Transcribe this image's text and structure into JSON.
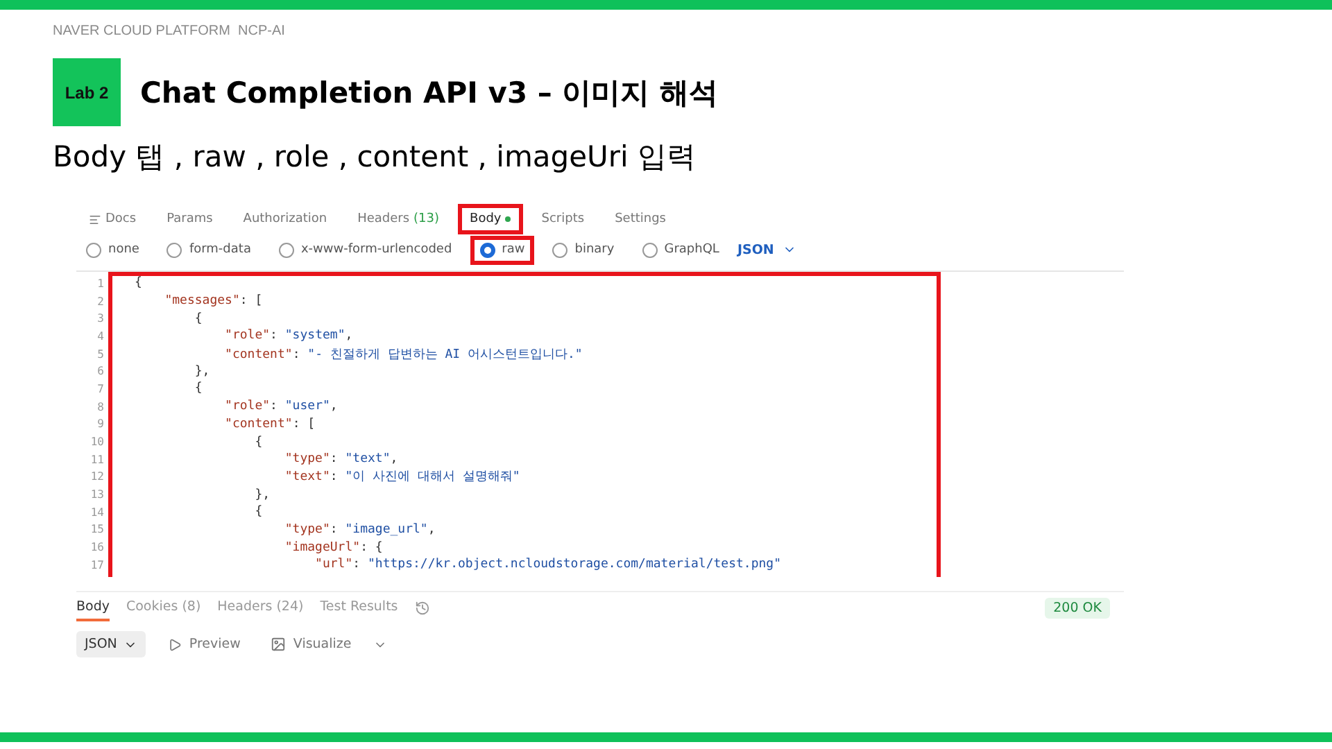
{
  "header": {
    "caption": "NAVER CLOUD PLATFORM  NCP-AI",
    "badge": "Lab 2",
    "title": "Chat Completion API v3 – 이미지 해석",
    "subtitle": "Body 탭 , raw , role , content , imageUri 입력"
  },
  "request_tabs": [
    {
      "label": "Docs",
      "kind": "docs",
      "selected": false,
      "highlighted": false
    },
    {
      "label": "Params",
      "selected": false,
      "highlighted": false
    },
    {
      "label": "Authorization",
      "selected": false,
      "highlighted": false
    },
    {
      "label": "Headers",
      "count": "(13)",
      "selected": false,
      "highlighted": false
    },
    {
      "label": "Body",
      "selected": true,
      "highlighted": true
    },
    {
      "label": "Scripts",
      "selected": false,
      "highlighted": false
    },
    {
      "label": "Settings",
      "selected": false,
      "highlighted": false
    }
  ],
  "body_types": [
    {
      "label": "none",
      "selected": false,
      "highlighted": false
    },
    {
      "label": "form-data",
      "selected": false,
      "highlighted": false
    },
    {
      "label": "x-www-form-urlencoded",
      "selected": false,
      "highlighted": false
    },
    {
      "label": "raw",
      "selected": true,
      "highlighted": true
    },
    {
      "label": "binary",
      "selected": false,
      "highlighted": false
    },
    {
      "label": "GraphQL",
      "selected": false,
      "highlighted": false
    }
  ],
  "format": "JSON",
  "editor": {
    "highlighted": true,
    "lines": [
      {
        "number": "1",
        "text": "{"
      },
      {
        "number": "2",
        "text": "    \"messages\": ["
      },
      {
        "number": "3",
        "text": "        {"
      },
      {
        "number": "4",
        "text": "            \"role\": \"system\","
      },
      {
        "number": "5",
        "text": "            \"content\": \"- 친절하게 답변하는 AI 어시스턴트입니다.\""
      },
      {
        "number": "6",
        "text": "        },"
      },
      {
        "number": "7",
        "text": "        {"
      },
      {
        "number": "8",
        "text": "            \"role\": \"user\","
      },
      {
        "number": "9",
        "text": "            \"content\": ["
      },
      {
        "number": "10",
        "text": "                {"
      },
      {
        "number": "11",
        "text": "                    \"type\": \"text\","
      },
      {
        "number": "12",
        "text": "                    \"text\": \"이 사진에 대해서 설명해줘\""
      },
      {
        "number": "13",
        "text": "                },"
      },
      {
        "number": "14",
        "text": "                {"
      },
      {
        "number": "15",
        "text": "                    \"type\": \"image_url\","
      },
      {
        "number": "16",
        "text": "                    \"imageUrl\": {"
      },
      {
        "number": "17",
        "text": "                        \"url\": \"https://kr.object.ncloudstorage.com/material/test.png\""
      }
    ]
  },
  "response_tabs": [
    {
      "label": "Body",
      "selected": true
    },
    {
      "label": "Cookies (8)",
      "selected": false
    },
    {
      "label": "Headers (24)",
      "selected": false
    },
    {
      "label": "Test Results",
      "selected": false
    }
  ],
  "status": "200 OK",
  "response_views": [
    {
      "label": "JSON",
      "kind": "format",
      "selected": true
    },
    {
      "label": "Preview",
      "kind": "preview",
      "selected": false
    },
    {
      "label": "Visualize",
      "kind": "visualize",
      "selected": false
    }
  ]
}
